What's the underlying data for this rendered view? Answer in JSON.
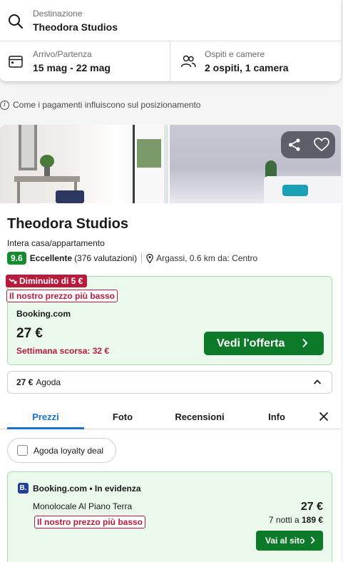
{
  "search": {
    "destination_label": "Destinazione",
    "destination_value": "Theodora Studios",
    "dates_label": "Arrivo/Partenza",
    "dates_value": "15 mag - 22 mag",
    "guests_label": "Ospiti e camere",
    "guests_value": "2 ospiti, 1 camera"
  },
  "notice": {
    "text": "Come i pagamenti influiscono sul posizionamento"
  },
  "hotel": {
    "name": "Theodora Studios",
    "type": "Intera casa/appartamento",
    "score": "9.6",
    "rating_word": "Eccellente",
    "review_count": "(376 valutazioni)",
    "location": "Argassi, 0.6 km da: Centro"
  },
  "deal": {
    "price_drop": "Diminuito di 5 €",
    "lowest_price": "Il nostro prezzo più basso",
    "provider": "Booking.com",
    "price": "27 €",
    "last_week": "Settimana scorsa: 32 €",
    "cta": "Vedi l'offerta"
  },
  "alternative": {
    "price": "27 €",
    "provider": "Agoda"
  },
  "tabs": [
    {
      "label": "Prezzi",
      "active": true
    },
    {
      "label": "Foto",
      "active": false
    },
    {
      "label": "Recensioni",
      "active": false
    },
    {
      "label": "Info",
      "active": false
    }
  ],
  "filter": {
    "loyalty_label": "Agoda loyalty deal",
    "checked": false
  },
  "offer": {
    "logo_letter": "B.",
    "header": "Booking.com • In evidenza",
    "room": "Monolocale Al Piano Terra",
    "lowest_price": "Il nostro prezzo più basso",
    "price": "27 €",
    "nights_text": "7 notti a",
    "nights_total": "189 €",
    "cta": "Vai al sito"
  },
  "colors": {
    "accent_green": "#0d7a2a",
    "score_green": "#138c2e",
    "deal_background": "#ebf8ec",
    "alert_red": "#b91b3c",
    "active_tab_blue": "#1a73c8"
  },
  "icons": [
    "search-icon",
    "calendar-icon",
    "guests-icon",
    "info-icon",
    "share-icon",
    "heart-icon",
    "location-pin-icon",
    "trend-down-icon",
    "chevron-right-icon",
    "chevron-up-icon",
    "close-icon"
  ]
}
